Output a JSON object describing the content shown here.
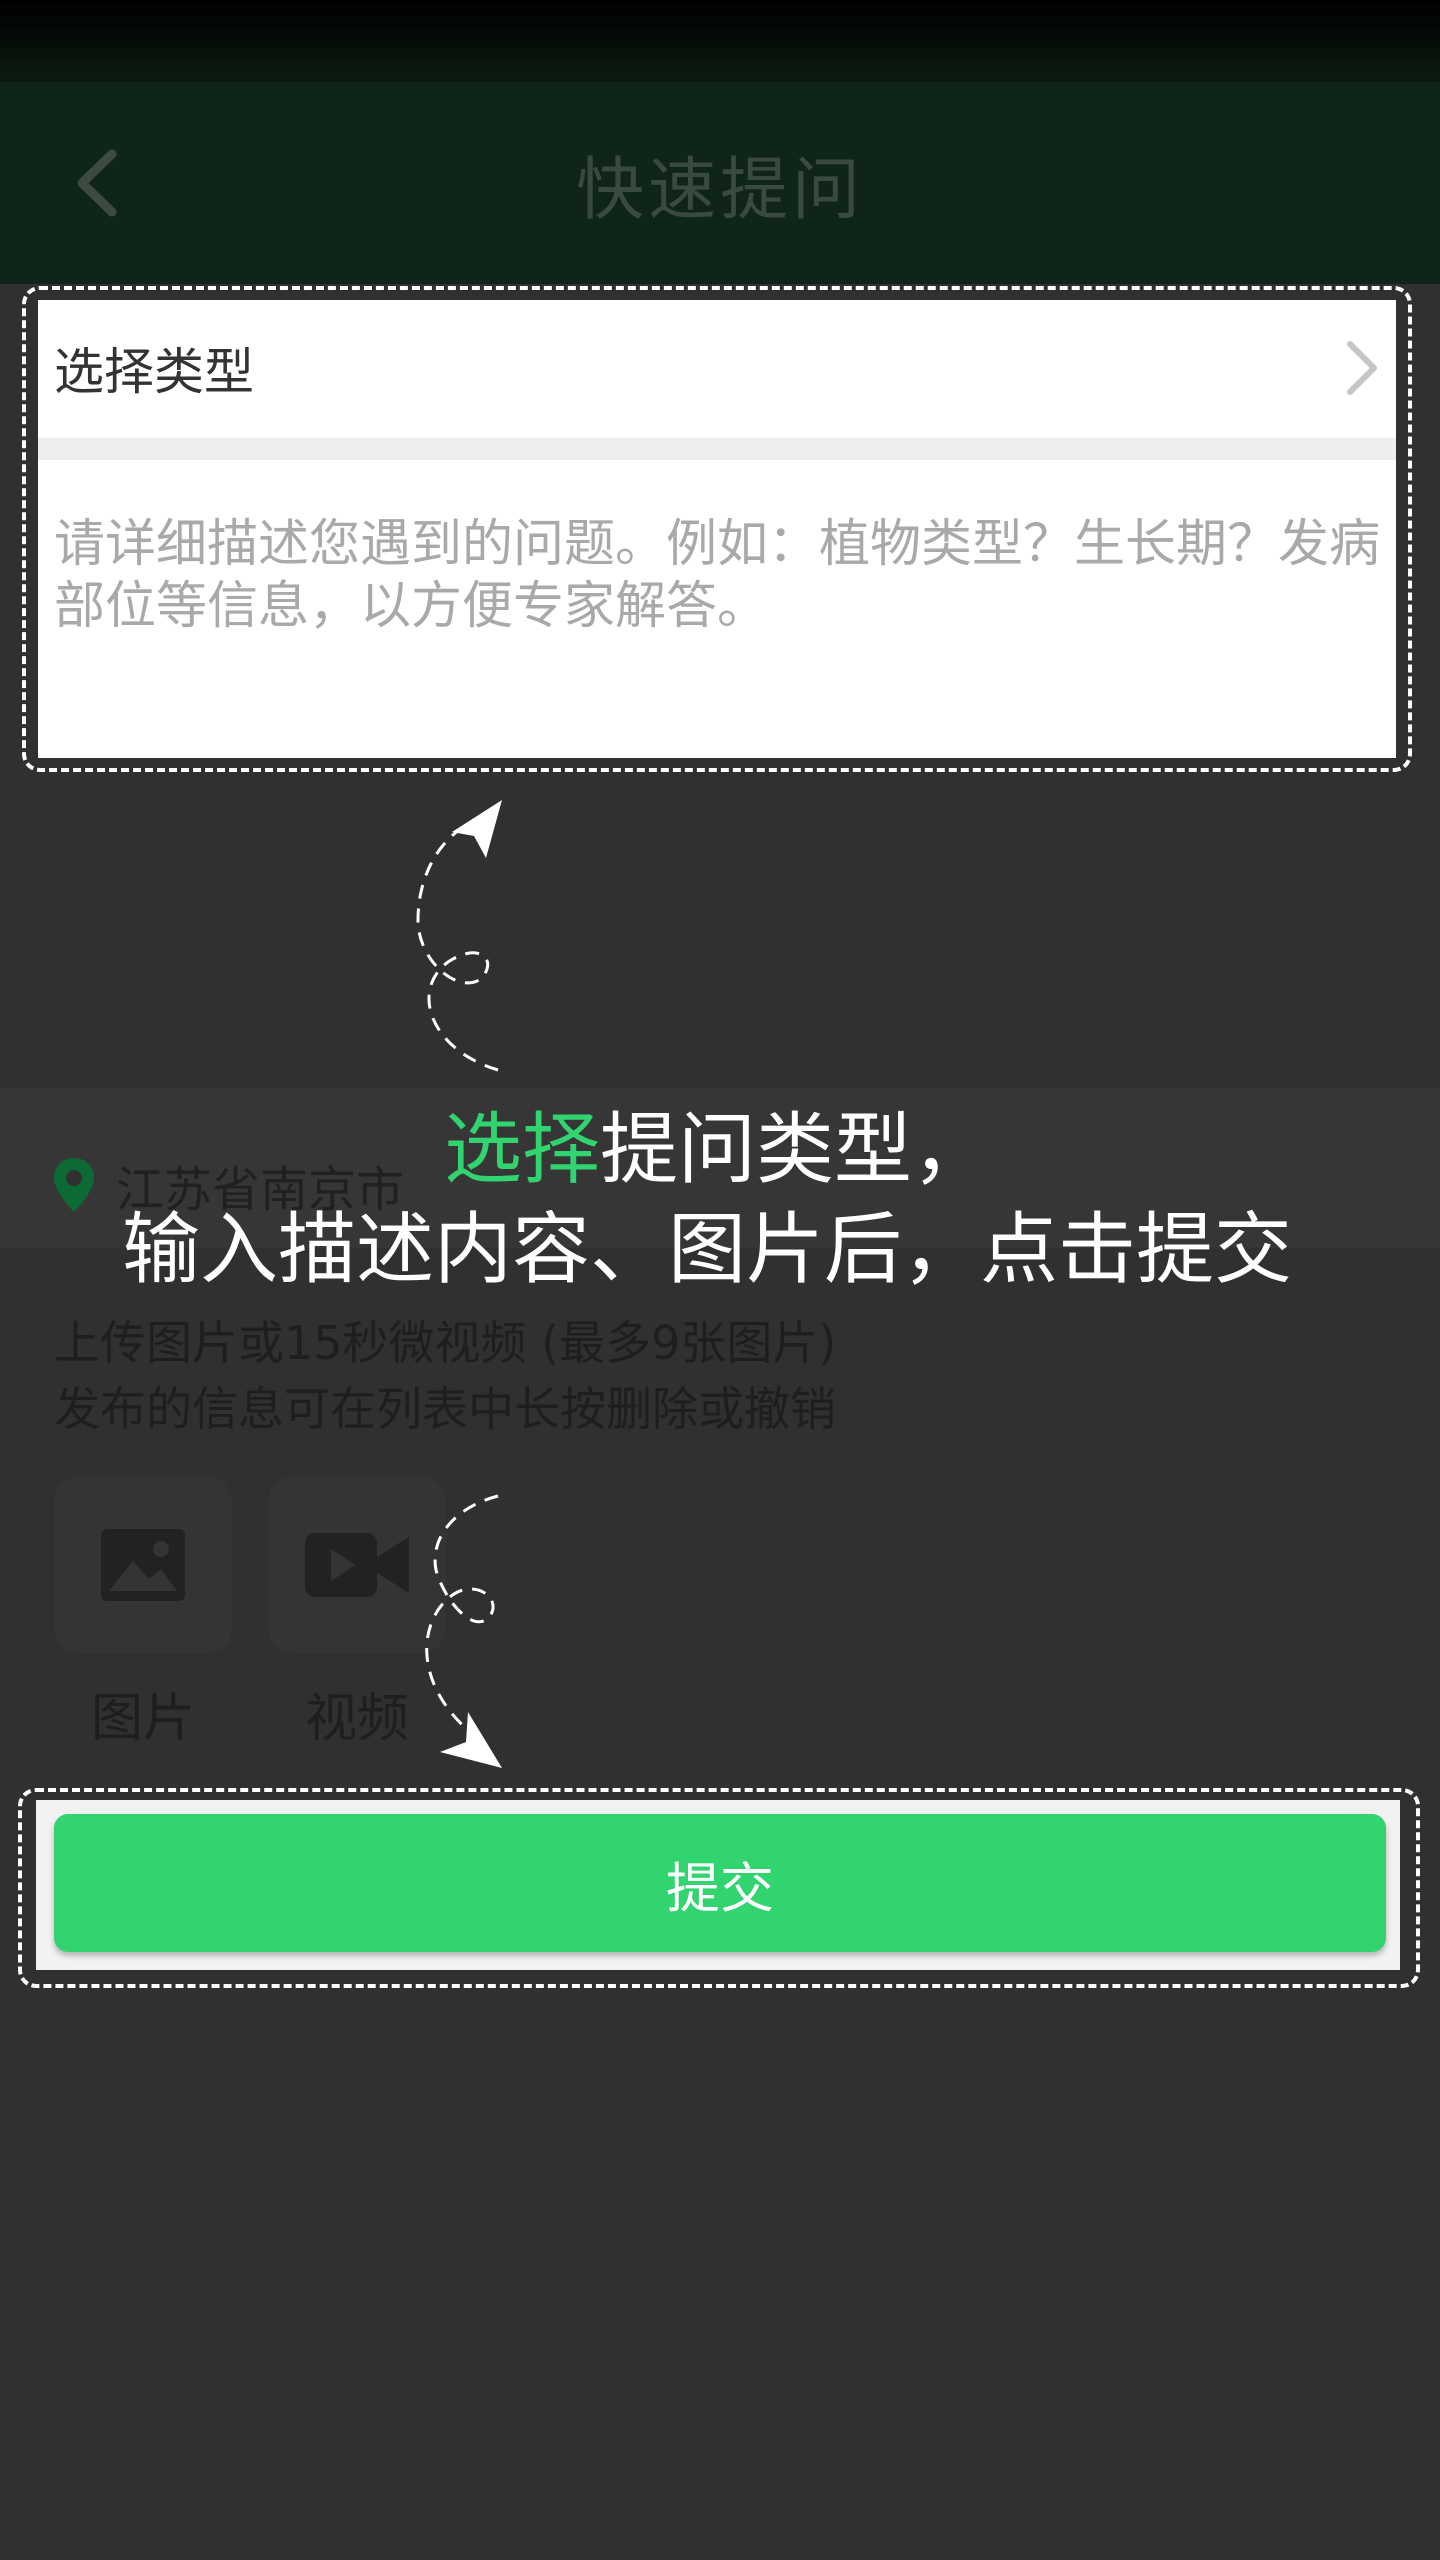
{
  "header": {
    "title": "快速提问",
    "back_icon": "chevron-left-icon"
  },
  "form": {
    "type_label": "选择类型",
    "type_icon": "chevron-right-icon",
    "description_placeholder": "请详细描述您遇到的问题。例如：植物类型？生长期？发病部位等信息，以方便专家解答。"
  },
  "location": {
    "icon": "location-pin-icon",
    "text": "江苏省南京市"
  },
  "upload": {
    "hint_line1": "上传图片或15秒微视频 (最多9张图片)",
    "hint_line2": "发布的信息可在列表中长按删除或撤销",
    "image_label": "图片",
    "image_icon": "image-icon",
    "video_label": "视频",
    "video_icon": "video-camera-icon"
  },
  "submit": {
    "label": "提交"
  },
  "guide": {
    "line1_highlight": "选择",
    "line1_rest": "提问类型，",
    "line2": "输入描述内容、图片后，点击提交"
  },
  "colors": {
    "accent": "#31d46f",
    "overlay": "#303030",
    "header": "#10251a"
  }
}
